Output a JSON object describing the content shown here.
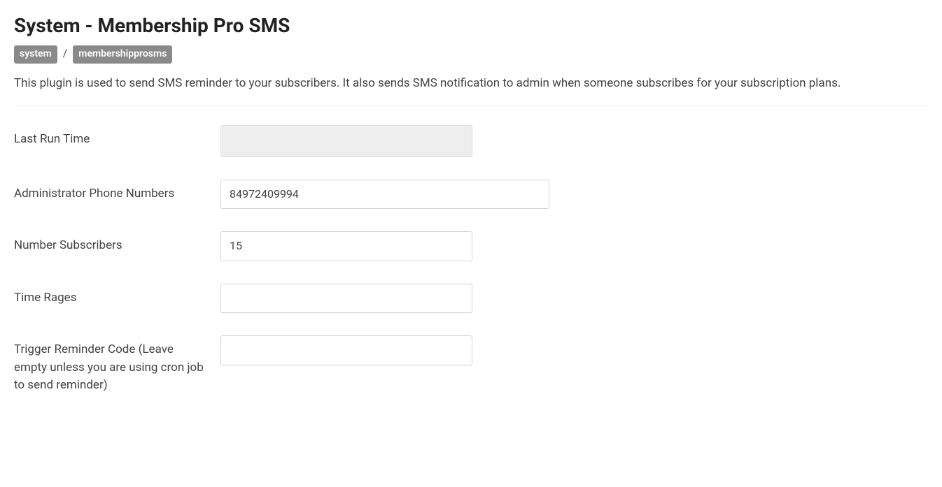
{
  "header": {
    "title": "System - Membership Pro SMS",
    "breadcrumb": {
      "group": "system",
      "element": "membershipprosms"
    },
    "description": "This plugin is used to send SMS reminder to your subscribers. It also sends SMS notification to admin when someone subscribes for your subscription plans."
  },
  "form": {
    "last_run_time": {
      "label": "Last Run Time",
      "value": ""
    },
    "admin_phone": {
      "label": "Administrator Phone Numbers",
      "value": "84972409994"
    },
    "number_subscribers": {
      "label": "Number Subscribers",
      "value": "15"
    },
    "time_rages": {
      "label": "Time Rages",
      "value": ""
    },
    "trigger_reminder_code": {
      "label": "Trigger Reminder Code (Leave empty unless you are using cron job to send reminder)",
      "value": ""
    }
  }
}
